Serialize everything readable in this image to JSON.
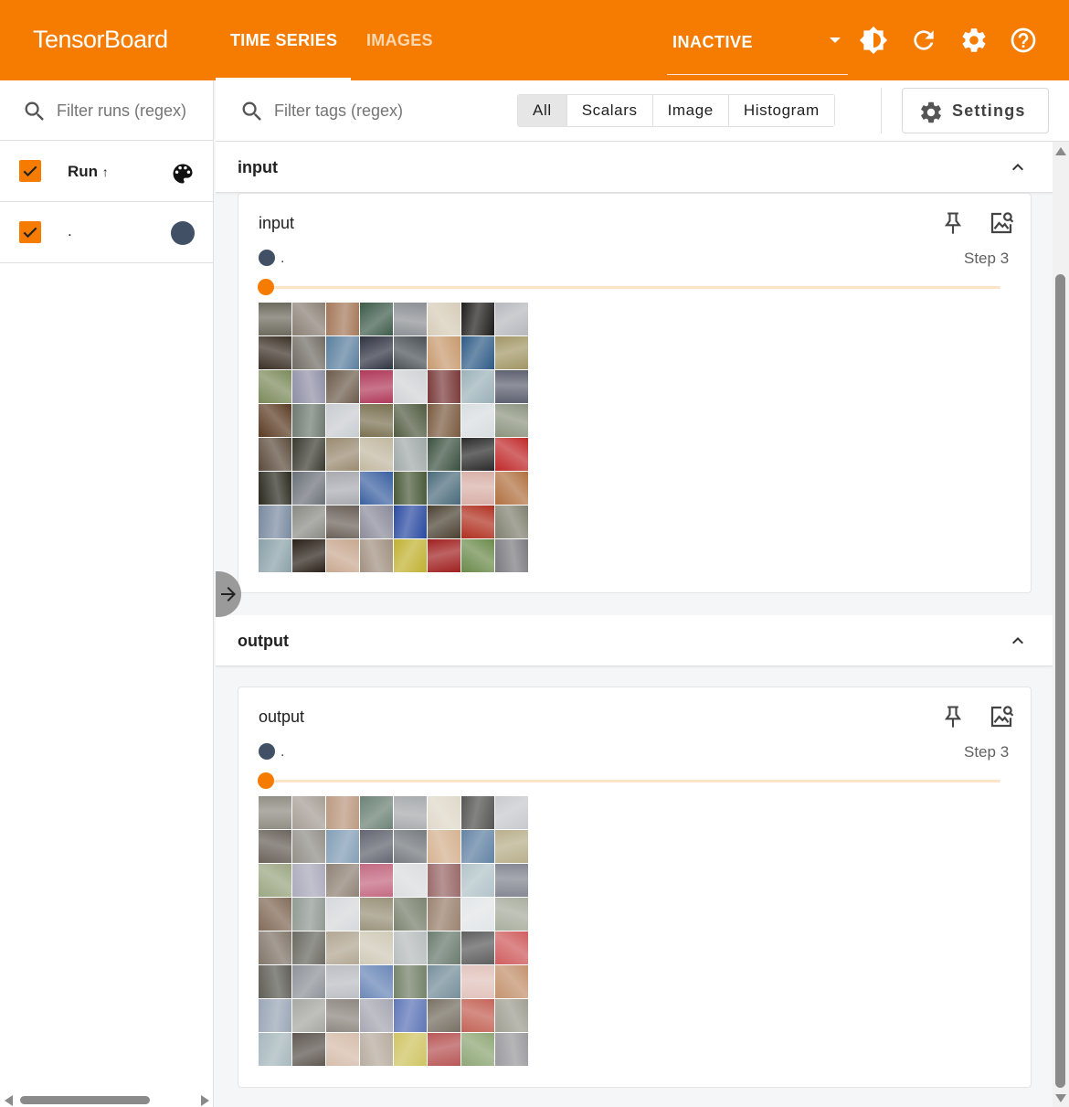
{
  "header": {
    "brand": "TensorBoard",
    "tabs": [
      {
        "label": "TIME SERIES",
        "active": true
      },
      {
        "label": "IMAGES",
        "active": false
      }
    ],
    "plugin_select": "INACTIVE",
    "icons": [
      "theme-icon",
      "refresh-icon",
      "settings-gear-icon",
      "help-icon"
    ],
    "accent": "#f57c00"
  },
  "sidebar": {
    "search_placeholder": "Filter runs (regex)",
    "column_header": "Run",
    "sort_indicator": "↑",
    "runs": [
      {
        "name": ".",
        "checked": true,
        "color": "#425066"
      }
    ]
  },
  "filter": {
    "placeholder": "Filter tags (regex)",
    "types": [
      "All",
      "Scalars",
      "Image",
      "Histogram"
    ],
    "selected_type": "All",
    "settings_label": "Settings"
  },
  "groups": [
    {
      "title": "input",
      "card": {
        "title": "input",
        "run": ".",
        "step_label": "Step 3",
        "slider_value": 0
      }
    },
    {
      "title": "output",
      "card": {
        "title": "output",
        "run": ".",
        "step_label": "Step 3",
        "slider_value": 0
      }
    }
  ],
  "image_palette": [
    "#6d6a5e",
    "#8a7f74",
    "#a5795a",
    "#3c5a4a",
    "#8c9094",
    "#d6ccb8",
    "#1e1d1c",
    "#b6b8bd",
    "#3b3026",
    "#706b63",
    "#5b7f9e",
    "#2f3341",
    "#4a5055",
    "#c79a6e",
    "#2e5a86",
    "#a29666",
    "#7b8a5a",
    "#8f8fa6",
    "#6b5a4a",
    "#b03a5a",
    "#d0d2d6",
    "#7a3a3a",
    "#9ab0b8",
    "#5d6170",
    "#5a3a22",
    "#6f7a72",
    "#c8ccd0",
    "#7a7050",
    "#4f5a40",
    "#7a5a40",
    "#d8dde0",
    "#8c9480",
    "#5a4a3a",
    "#3a3a30",
    "#9a8a70",
    "#c2b8a0",
    "#a0a8a8",
    "#3a5040",
    "#2a2a2a",
    "#c0282a",
    "#2a2a20",
    "#6a7078",
    "#a8aab0",
    "#3a60a0",
    "#4a5a3a",
    "#4a6a7a",
    "#d8b0a8",
    "#b07040",
    "#7a8aa0",
    "#8a8a84",
    "#6a6058",
    "#8a8a9a",
    "#2a4aa0",
    "#4a4030",
    "#b03020",
    "#808070",
    "#8aa0a8",
    "#2a2018",
    "#c8a890",
    "#a09080",
    "#c0b030",
    "#a02020",
    "#6a8a4a",
    "#7a7a80"
  ]
}
